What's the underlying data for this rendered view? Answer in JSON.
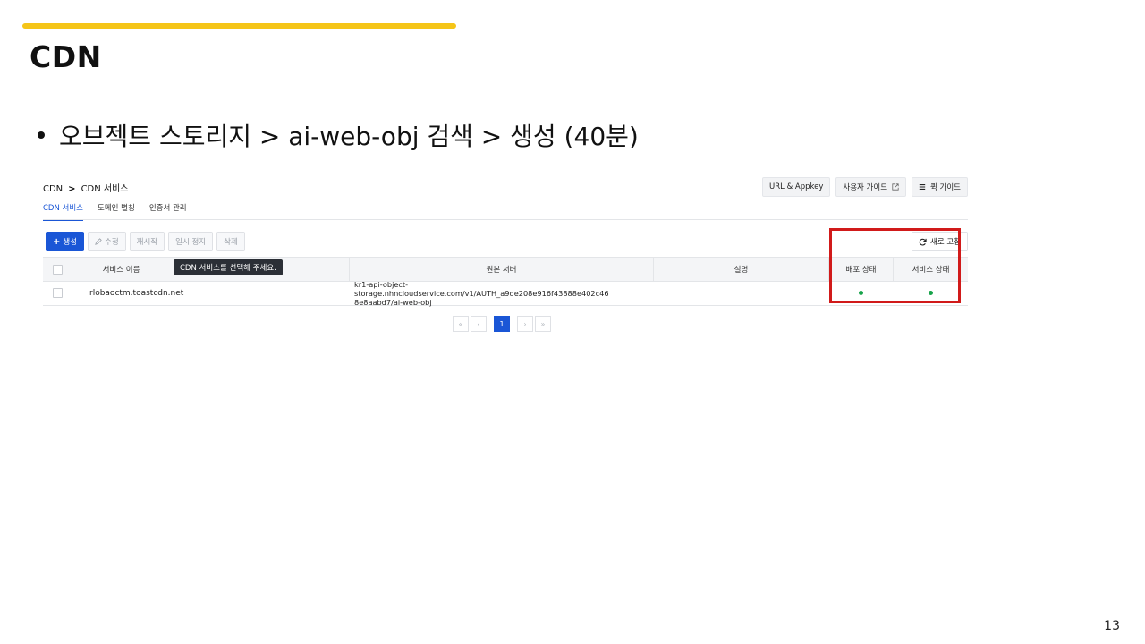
{
  "slide": {
    "title": "CDN",
    "bullet": "오브젝트 스토리지 > ai-web-obj 검색 > 생성 (40분)",
    "page_number": "13",
    "accent_color": "#f5c518",
    "highlight_color": "#d11a1a"
  },
  "console": {
    "breadcrumb": {
      "root": "CDN",
      "separator": ">",
      "current": "CDN 서비스"
    },
    "top_buttons": {
      "url_appkey": "URL & Appkey",
      "user_guide": "사용자 가이드",
      "quick_guide": "퀵 가이드"
    },
    "tabs": [
      "CDN 서비스",
      "도메인 별칭",
      "인증서 관리"
    ],
    "toolbar": {
      "create": "생성",
      "edit": "수정",
      "restart": "재시작",
      "pause": "일시 정지",
      "delete": "삭제",
      "refresh": "새로 고침"
    },
    "tooltip": "CDN 서비스를 선택해 주세요.",
    "table": {
      "columns": [
        "서비스 이름",
        "원본 서버",
        "설명",
        "배포 상태",
        "서비스 상태"
      ],
      "rows": [
        {
          "service_name": "rlobaoctm.toastcdn.net",
          "origin_line1": "kr1-api-object-storage.nhncloudservice.com/v1/AUTH_a9de208e916f43888e402c46",
          "origin_line2": "8e8aabd7/ai-web-obj",
          "description": "",
          "deploy_status": "green",
          "service_status": "green"
        }
      ]
    },
    "pagination": {
      "current_page": "1",
      "first": "«",
      "prev": "‹",
      "next": "›",
      "last": "»"
    }
  }
}
